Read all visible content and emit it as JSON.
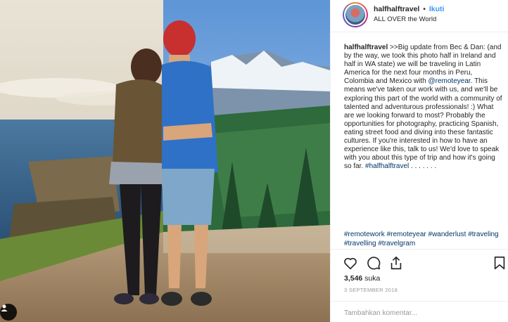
{
  "post": {
    "username": "halfhalftravel",
    "separator": "•",
    "follow_label": "Ikuti",
    "location": "ALL OVER the World"
  },
  "caption": {
    "username": "halfhalftravel",
    "text_part1": " >>Big update from Bec & Dan: (and by the way, we took this photo half in Ireland and half in WA state) we will be traveling in Latin America for the next four months in Peru, Colombia and Mexico with ",
    "mention": "@remoteyear",
    "text_part2": ". This means we've taken our work with us, and we'll be exploring this part of the world with a community of talented and adventurous professionals! :) What are we looking forward to most? Probably the opportunities for photography, practicing Spanish, eating street food and diving into these fantastic cultures. If you're interested in how to have an experience like this, talk to us! We'd love to speak with you about this type of trip and how it's going so far. ",
    "hashtag": "#halfhalftravel",
    "trail": " . . . . . . ."
  },
  "hashtags": [
    "#remotework",
    "#remoteyear",
    "#wanderlust",
    "#traveling",
    "#travelling",
    "#travelgram"
  ],
  "likes": {
    "count": "3,546",
    "label": "suka"
  },
  "date": "3 SEPTEMBER 2018",
  "comment": {
    "placeholder": "Tambahkan komentar..."
  },
  "icons": {
    "like": "heart-icon",
    "comment": "comment-icon",
    "share": "share-icon",
    "save": "bookmark-icon",
    "tag": "user-tag-icon"
  },
  "colors": {
    "link": "#003569",
    "follow": "#3897f0",
    "muted": "#999999"
  }
}
